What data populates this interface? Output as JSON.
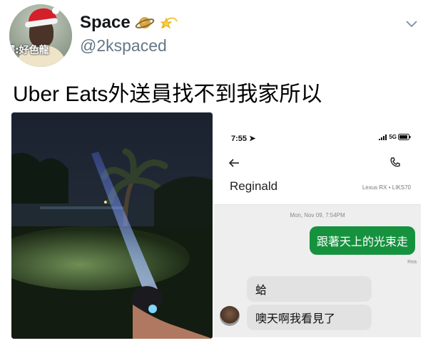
{
  "tweet": {
    "display_name": "Space",
    "handle": "@2kspaced",
    "avatar_watermark": "譯:好色龍",
    "text": "Uber Eats外送員找不到我家所以",
    "emoji": [
      "ringed-planet-icon",
      "dizzy-star-icon"
    ]
  },
  "phone": {
    "status_time": "7:55",
    "network": "5G",
    "contact_name": "Reginald",
    "vehicle": "Lexus RX • LIKS70",
    "chat_timestamp": "Mon, Nov 09, 7:54PM",
    "read_label": "Rea",
    "messages": [
      {
        "from": "user",
        "text": "跟著天上的光束走"
      },
      {
        "from": "driver",
        "text": "蛤"
      },
      {
        "from": "driver",
        "text": "噢天啊我看見了"
      }
    ]
  },
  "colors": {
    "outgoing_bubble": "#16923f",
    "incoming_bubble": "#e2e2e2",
    "handle_gray": "#657786"
  }
}
